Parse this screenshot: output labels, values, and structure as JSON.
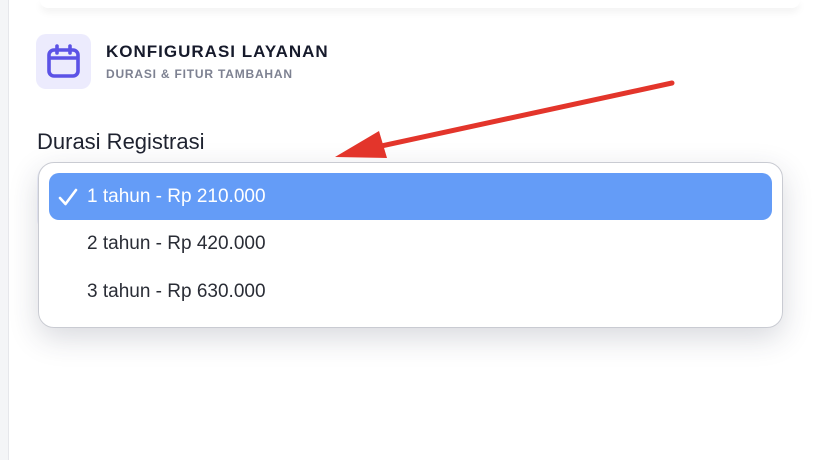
{
  "header": {
    "title": "KONFIGURASI LAYANAN",
    "subtitle": "DURASI & FITUR TAMBAHAN",
    "icon": "calendar-icon"
  },
  "field": {
    "label": "Durasi Registrasi"
  },
  "dropdown": {
    "options": [
      {
        "label": "1 tahun - Rp 210.000",
        "selected": true
      },
      {
        "label": "2 tahun - Rp 420.000",
        "selected": false
      },
      {
        "label": "3 tahun - Rp 630.000",
        "selected": false
      }
    ]
  },
  "colors": {
    "accent": "#649cf7",
    "icon": "#5b52e6",
    "icon_bg": "#ecebfd",
    "annotation_arrow": "#e3352b"
  }
}
